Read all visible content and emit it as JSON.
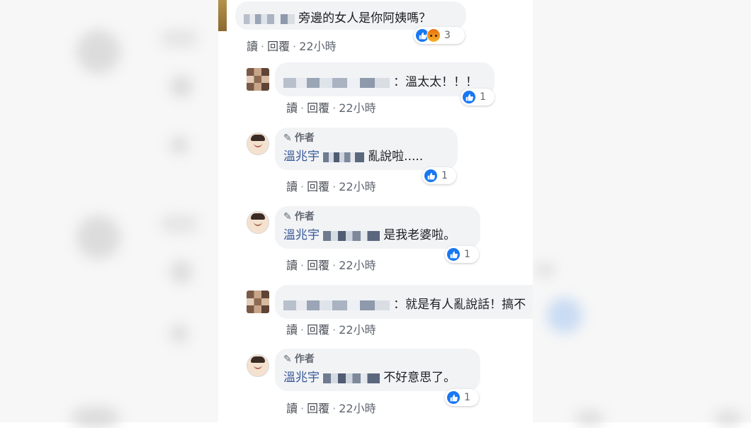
{
  "meta_labels": {
    "read": "讀",
    "reply": "回覆",
    "time": "22小時"
  },
  "author_badge": "作者",
  "author_name": "溫兆宇",
  "icons": {
    "like": "like-icon",
    "angry": "angry-icon",
    "pen": "pen-icon"
  },
  "colors": {
    "like_blue": "#1877f2",
    "name_blue": "#385898",
    "bubble_gray": "#f2f3f5"
  },
  "comments": [
    {
      "text": "旁邊的女人是你阿姨嗎？",
      "reactions": [
        "like",
        "angry"
      ],
      "count": "3"
    },
    {
      "text": "：溫太太！！！",
      "reactions": [
        "like"
      ],
      "count": "1"
    },
    {
      "text": "亂說啦.....",
      "reactions": [
        "like"
      ],
      "count": "1"
    },
    {
      "text": "是我老婆啦。",
      "reactions": [
        "like"
      ],
      "count": "1"
    },
    {
      "text": "：就是有人亂說話！搞不",
      "reactions": [],
      "count": ""
    },
    {
      "text": "不好意思了。",
      "reactions": [
        "like"
      ],
      "count": "1"
    }
  ]
}
